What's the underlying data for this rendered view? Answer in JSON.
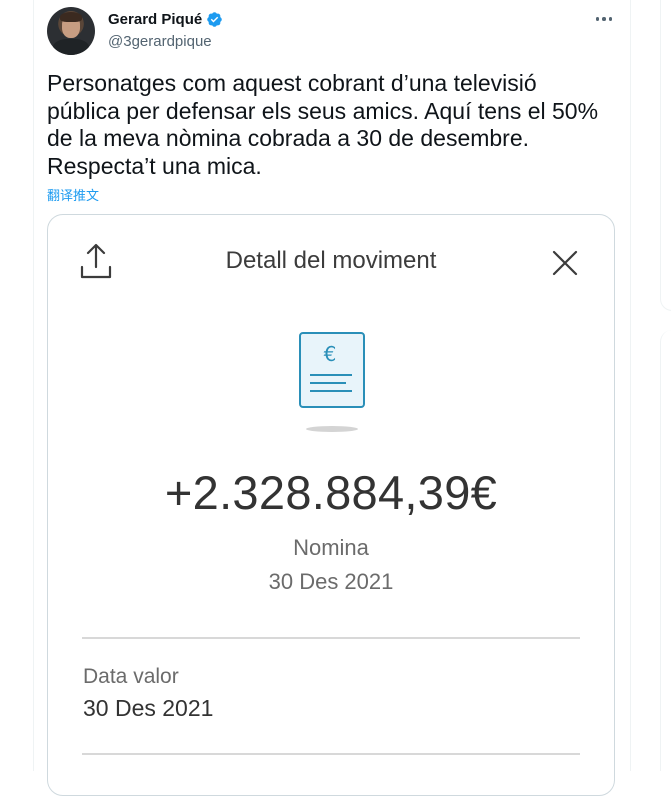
{
  "tweet": {
    "display_name": "Gerard Piqué",
    "handle": "@3gerardpique",
    "text": "Personatges com aquest cobrant d’una televisió\npública per defensar els seus amics. Aquí tens el 50%\nde la meva nòmina cobrada a 30 de desembre.\nRespecta’t una mica.",
    "translate_label": "翻译推文",
    "verified_color": "#1d9bf0",
    "more_icon": "more-horizontal-icon"
  },
  "card": {
    "title": "Detall del moviment",
    "amount": "+2.328.884,39€",
    "concept": "Nomina",
    "date": "30 Des 2021",
    "field_label": "Data valor",
    "field_value": "30 Des 2021",
    "accent_color": "#2a8fb8",
    "icons": [
      "share-icon",
      "close-icon",
      "euro-document-icon"
    ]
  }
}
